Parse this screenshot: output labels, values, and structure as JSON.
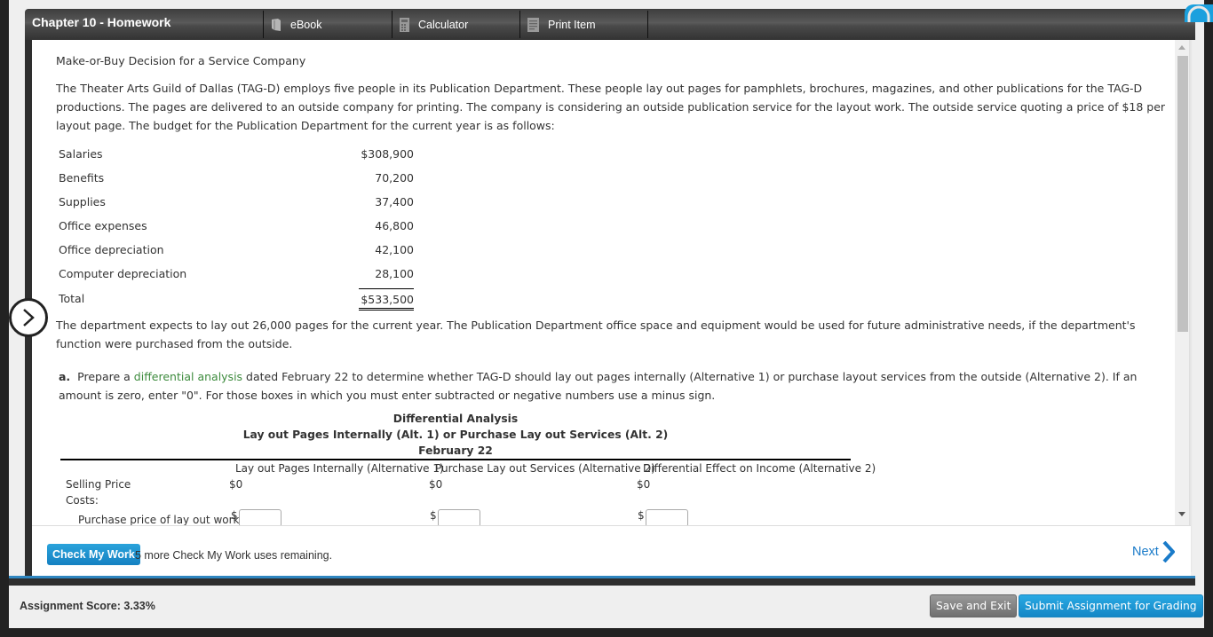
{
  "header": {
    "title": "Chapter 10 - Homework",
    "tools": [
      {
        "label": "eBook",
        "icon": "book-icon"
      },
      {
        "label": "Calculator",
        "icon": "calculator-icon"
      },
      {
        "label": "Print Item",
        "icon": "print-icon"
      }
    ]
  },
  "problem": {
    "title": "Make-or-Buy Decision for a Service Company",
    "intro": "The Theater Arts Guild of Dallas (TAG-D) employs five people in its Publication Department. These people lay out pages for pamphlets, brochures, magazines, and other publications for the TAG-D productions. The pages are delivered to an outside company for printing. The company is considering an outside publication service for the layout work. The outside service quoting a price of $18 per layout page. The budget for the Publication Department for the current year is as follows:",
    "budget": [
      {
        "label": "Salaries",
        "value": "$308,900"
      },
      {
        "label": "Benefits",
        "value": "70,200"
      },
      {
        "label": "Supplies",
        "value": "37,400"
      },
      {
        "label": "Office expenses",
        "value": "46,800"
      },
      {
        "label": "Office depreciation",
        "value": "42,100"
      },
      {
        "label": "Computer depreciation",
        "value": "28,100"
      },
      {
        "label": "Total",
        "value": "$533,500"
      }
    ],
    "expectation": "The department expects to lay out 26,000 pages for the current year. The Publication Department office space and equipment would be used for future administrative needs, if the department's function were purchased from the outside.",
    "part_a": {
      "letter": "a.",
      "pre": "Prepare a",
      "link": "differential analysis",
      "post": "dated February 22 to determine whether TAG-D should lay out pages internally (Alternative 1) or purchase layout services from the outside (Alternative 2). If an amount is zero, enter \"0\". For those boxes in which you must enter subtracted or negative numbers use a minus sign."
    }
  },
  "analysis": {
    "heading1": "Differential Analysis",
    "heading2": "Lay out Pages Internally (Alt. 1) or Purchase Lay out Services (Alt. 2)",
    "heading3": "February 22",
    "columns": [
      "Lay out Pages Internally (Alternative 1)",
      "Purchase Lay out Services (Alternative 2)",
      "Differential Effect on Income (Alternative 2)"
    ],
    "rows": {
      "selling_price": {
        "label": "Selling Price",
        "values": [
          "$0",
          "$0",
          "$0"
        ]
      },
      "costs": {
        "label": "Costs:"
      },
      "purchase_price": {
        "label": "Purchase price of lay out work",
        "currency": "$",
        "inputs": [
          "",
          "",
          ""
        ]
      }
    }
  },
  "actions": {
    "check_label": "Check My Work",
    "check_note": "5 more Check My Work uses remaining.",
    "next_label": "Next"
  },
  "footer": {
    "score": "Assignment Score: 3.33%",
    "save_label": "Save and Exit",
    "submit_label": "Submit Assignment for Grading"
  },
  "colors": {
    "accent_blue": "#1a8fd0",
    "link_green": "#3d8b3d",
    "header_dark": "#4a4a4a"
  }
}
